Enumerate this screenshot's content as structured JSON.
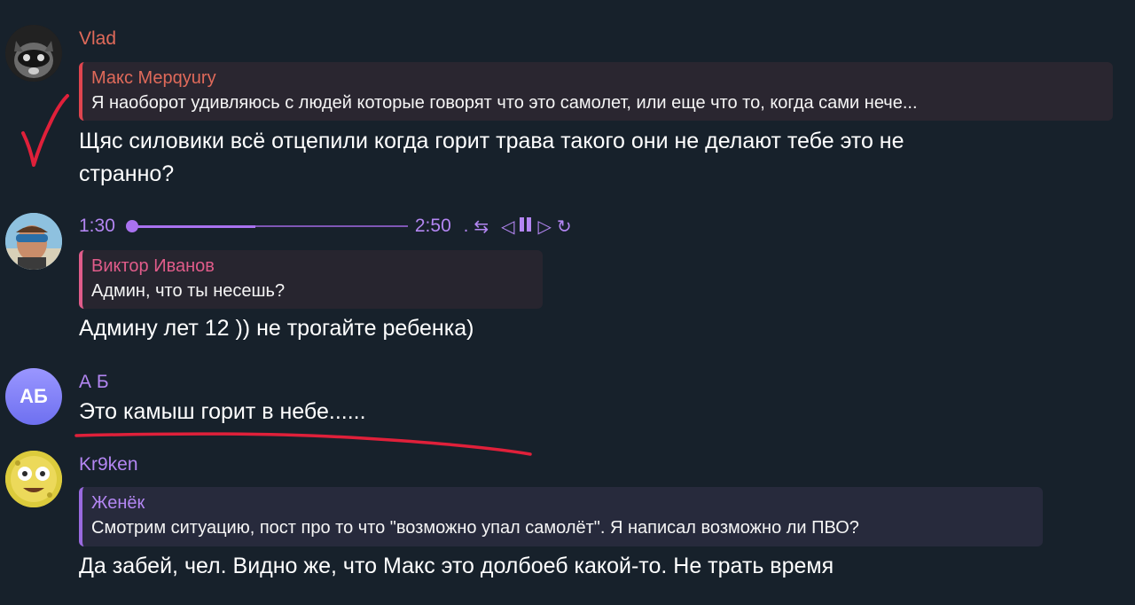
{
  "messages": [
    {
      "author": "Vlad",
      "author_color": "#e06a5a",
      "reply": {
        "name": "Макс Мерqyury",
        "text": "Я наоборот удивляюсь с людей которые говорят что это самолет, или еще что то, когда сами нече..."
      },
      "text_line1": "Щяс силовики  всё  отцепили когда  горит  трава  такого они не делают  тебе это не",
      "text_line2": "странно?"
    },
    {
      "author": "",
      "player": {
        "current": "1:30",
        "total": "2:50",
        "speed": ".",
        "progress": 0.46
      },
      "reply": {
        "name": "Виктор Иванов",
        "text": "Админ, что ты несешь?"
      },
      "text_line1": "Админу лет 12 )) не трогайте ребенка)"
    },
    {
      "author": "А Б",
      "avatar_initials": "АБ",
      "text_line1": "Это камыш горит в небе......"
    },
    {
      "author": "Kr9ken",
      "reply": {
        "name": "Женёк",
        "text": "Смотрим ситуацию, пост про то что \"возможно упал самолёт\". Я написал возможно ли ПВО?"
      },
      "text_line1": "Да забей, чел. Видно же, что Макс это долбоеб какой-то. Не трать время"
    }
  ],
  "colors": {
    "background": "#17212b",
    "vlad": "#e06a5a",
    "reply_pink": "#e05c8a",
    "purple": "#b386f2",
    "annotation_red": "#e0203a"
  }
}
